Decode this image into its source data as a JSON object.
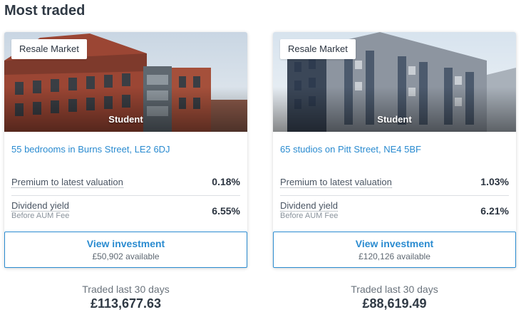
{
  "section": {
    "title": "Most traded"
  },
  "cards": [
    {
      "tag": "Resale Market",
      "type": "Student",
      "title": "55 bedrooms in Burns Street, LE2 6DJ",
      "premium_label": "Premium to latest valuation",
      "premium_value": "0.18%",
      "dividend_label": "Dividend yield",
      "dividend_sub": "Before AUM Fee",
      "dividend_value": "6.55%",
      "button_label": "View investment",
      "button_sub": "£50,902 available",
      "traded_label": "Traded last 30 days",
      "traded_value": "£113,677.63",
      "image": "red-brick-building"
    },
    {
      "tag": "Resale Market",
      "type": "Student",
      "title": "65 studios on Pitt Street, NE4 5BF",
      "premium_label": "Premium to latest valuation",
      "premium_value": "1.03%",
      "dividend_label": "Dividend yield",
      "dividend_sub": "Before AUM Fee",
      "dividend_value": "6.21%",
      "button_label": "View investment",
      "button_sub": "£120,126 available",
      "traded_label": "Traded last 30 days",
      "traded_value": "£88,619.49",
      "image": "grey-clad-building"
    }
  ],
  "colors": {
    "link": "#2a8bd0",
    "text": "#2b3440",
    "muted": "#8a939c",
    "border": "#2a8bd0"
  }
}
